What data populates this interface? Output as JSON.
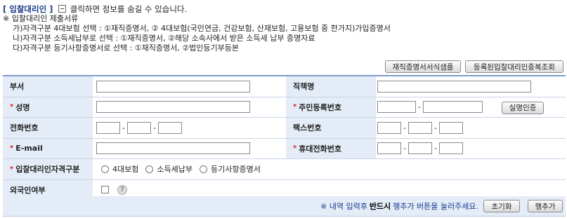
{
  "header": {
    "title": "[ 입찰대리인 ]",
    "toggle_text": "클릭하면 정보를 숨길 수 있습니다."
  },
  "notes": {
    "title": "※ 입찰대리인 제출서류",
    "lines": [
      "가)자격구분 4대보험 선택 : ①재직증명서, ② 4대보험(국민연금, 건강보험, 산재보험, 고용보험 중 한가지)가입증명서",
      "나)자격구분 소득세납부로 선택 : ①재직증명서, ②해당 소속사에서 받은 소득세 납부 증명자료",
      "다)자격구분 등기사항증명서로 선택 : ①재직증명서, ②법인등기부등본"
    ]
  },
  "top_buttons": {
    "sample": "재직증명서서식샘플",
    "duplicate": "등록된입찰대리인중복조회"
  },
  "form": {
    "required_mark": "*",
    "dept_label": "부서",
    "position_label": "직책명",
    "name_label": "성명",
    "rrn_label": "주민등록번호",
    "verify_button": "실명인증",
    "phone_label": "전화번호",
    "fax_label": "팩스번호",
    "email_label": "E-mail",
    "mobile_label": "휴대전화번호",
    "qual_label": "입찰대리인자격구분",
    "qual_options": [
      "4대보험",
      "소득세납부",
      "등기사항증명서"
    ],
    "foreign_label": "외국인여부",
    "help_icon": "?",
    "dash": "-"
  },
  "footer": {
    "msg_before": "※ 내역 입력후",
    "msg_bold": "반드시",
    "msg_after": "행추가 버튼을 눌러주세요.",
    "reset_button": "초기화",
    "add_row_button": "행추가"
  },
  "colors": {
    "label_bg": "#e4ecf7",
    "accent": "#1a3c8c",
    "required": "#dd2222",
    "border": "#7f9ccf"
  }
}
